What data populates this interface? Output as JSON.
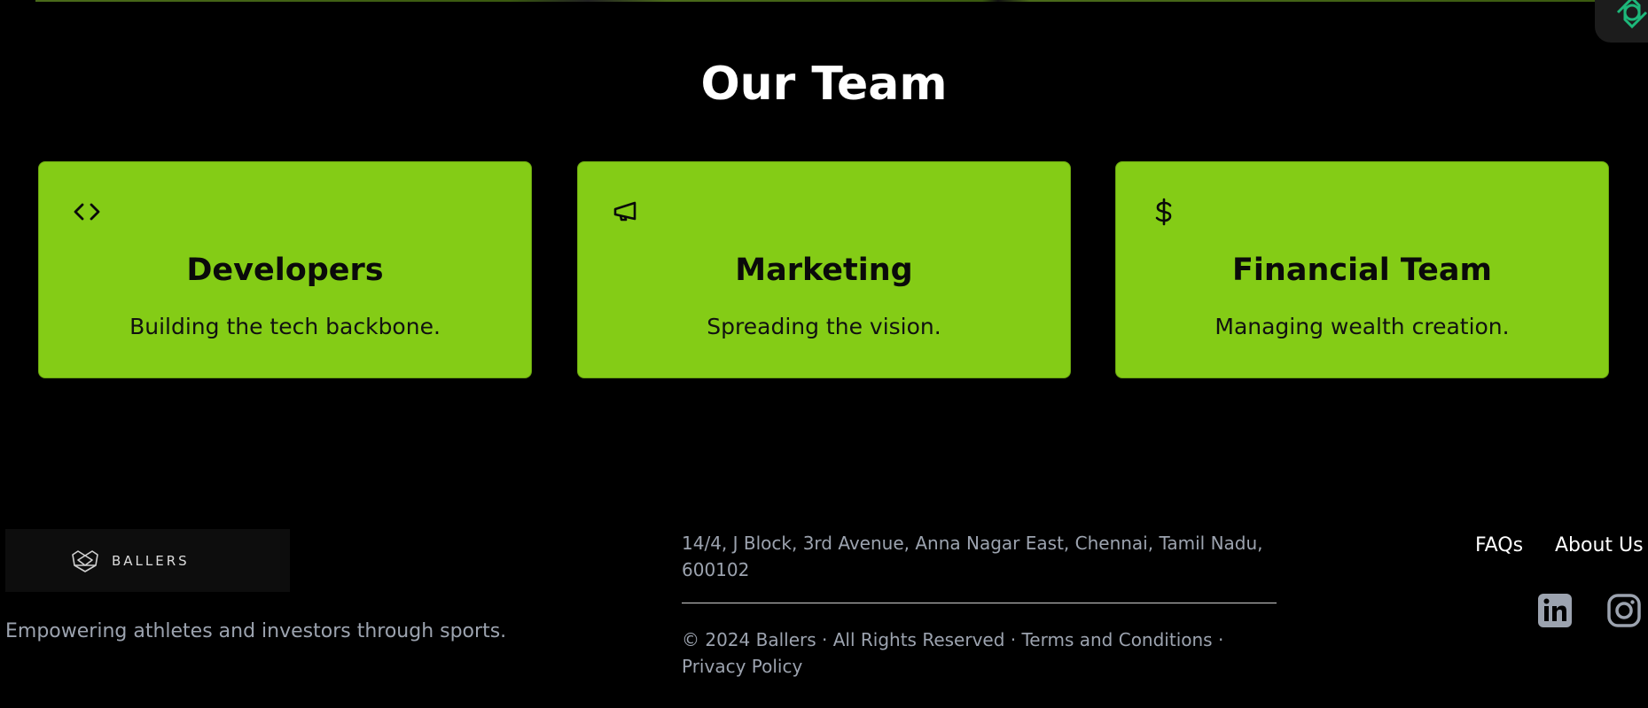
{
  "team": {
    "title": "Our Team",
    "cards": [
      {
        "icon": "code-icon",
        "title": "Developers",
        "description": "Building the tech backbone."
      },
      {
        "icon": "megaphone-icon",
        "title": "Marketing",
        "description": "Spreading the vision."
      },
      {
        "icon": "dollar-icon",
        "title": "Financial Team",
        "description": "Managing wealth creation."
      }
    ]
  },
  "footer": {
    "logo_text": "BALLERS",
    "tagline": "Empowering athletes and investors through sports.",
    "address": "14/4, J Block, 3rd Avenue, Anna Nagar East, Chennai, Tamil Nadu, 600102",
    "copyright_prefix": "© 2024 Ballers · All Rights Reserved · ",
    "terms_label": "Terms and Conditions",
    "separator": " · ",
    "privacy_label": "Privacy Policy",
    "nav": {
      "faqs": "FAQs",
      "about": "About Us"
    },
    "social": [
      "linkedin-icon",
      "instagram-icon"
    ]
  },
  "colors": {
    "background": "#000000",
    "card_accent": "#84cc16",
    "muted_text": "#9ca3af"
  }
}
